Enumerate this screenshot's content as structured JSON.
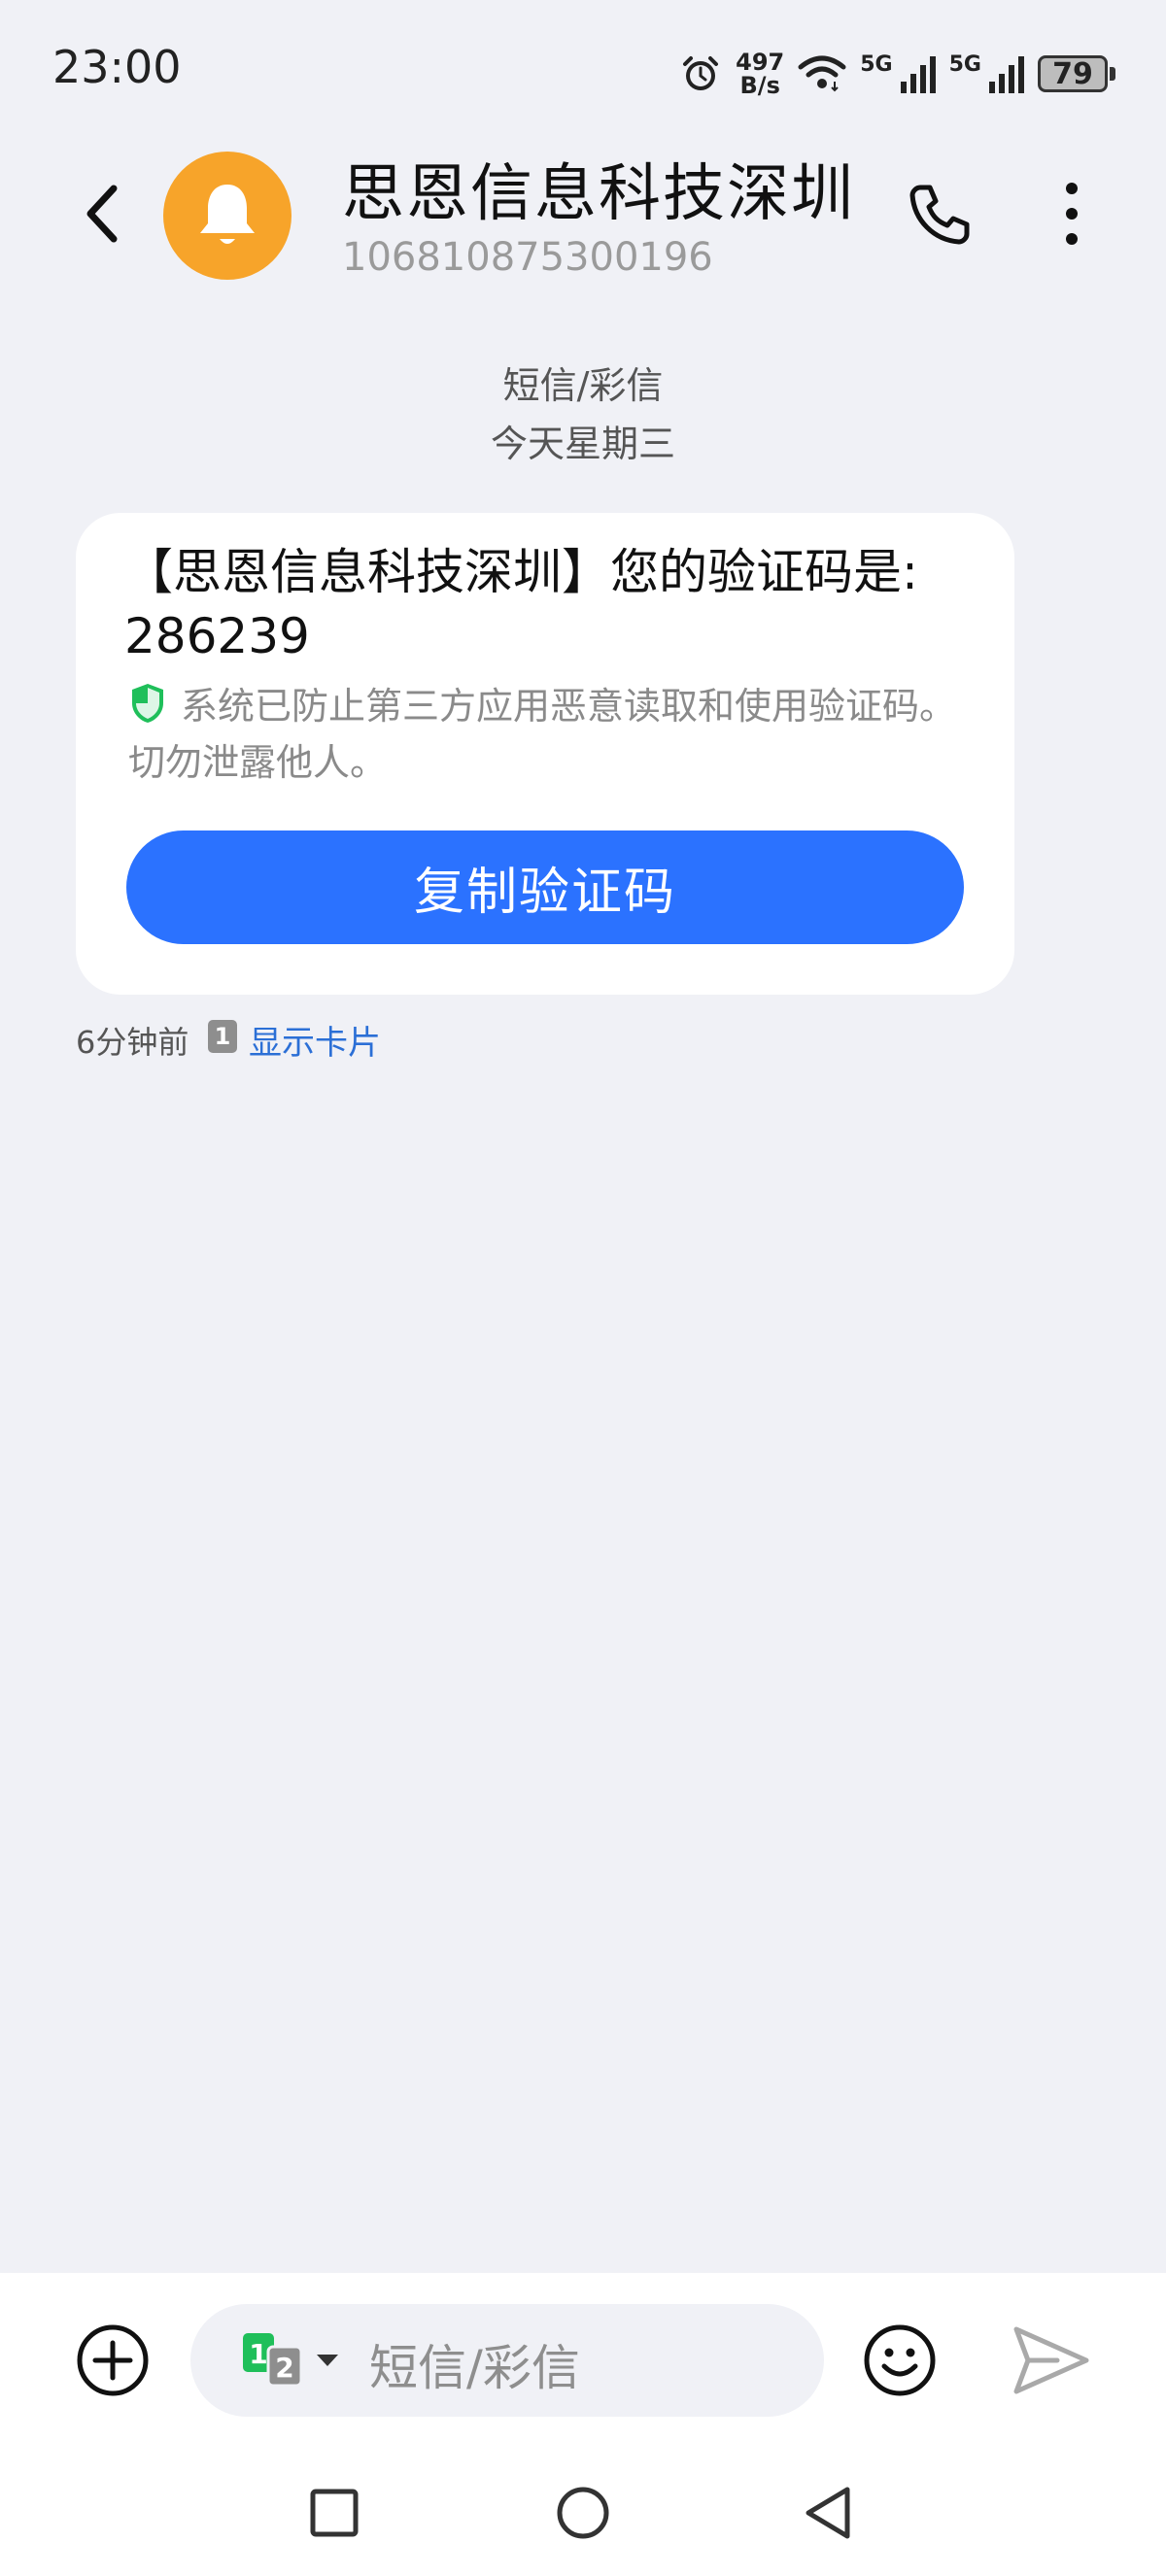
{
  "status_bar": {
    "time": "23:00",
    "net_rate_value": "497",
    "net_rate_unit": "B/s",
    "sim1_network": "5G",
    "sim2_network": "5G",
    "battery": "79"
  },
  "header": {
    "contact_name": "思恩信息科技深圳",
    "contact_number": "106810875300196"
  },
  "thread": {
    "message_type": "短信/彩信",
    "day_label": "今天星期三"
  },
  "message": {
    "text_line1": "【思恩信息科技深圳】您的验证码是:",
    "text_line2": "286239",
    "security_notice_line1": "系统已防止第三方应用恶意读取和使用验证码。",
    "security_notice_line2": "切勿泄露他人。",
    "copy_button_label": "复制验证码",
    "time_ago": "6分钟前",
    "sim_badge": "1",
    "show_card_label": "显示卡片"
  },
  "compose": {
    "placeholder": "短信/彩信",
    "sim_primary": "1",
    "sim_secondary": "2"
  },
  "colors": {
    "accent": "#2b72ff",
    "avatar": "#f7a42a",
    "shield": "#1fbf5a",
    "link": "#2b6fd6",
    "background": "#f0f1f6"
  },
  "icons": [
    "alarm-icon",
    "wifi-icon",
    "signal-icon",
    "battery-icon",
    "back-arrow-icon",
    "bell-icon",
    "phone-icon",
    "more-vert-icon",
    "shield-icon",
    "add-icon",
    "sim-switch-icon",
    "emoji-icon",
    "send-icon",
    "nav-recent-icon",
    "nav-home-icon",
    "nav-back-icon"
  ]
}
